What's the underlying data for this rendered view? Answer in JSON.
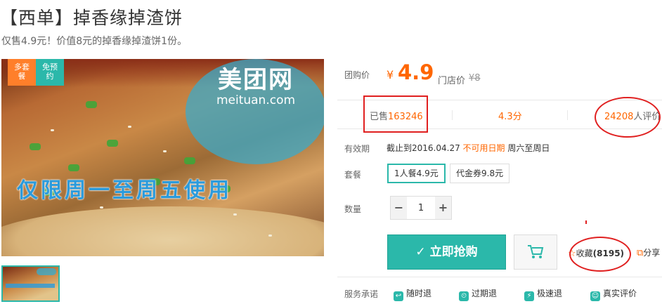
{
  "deal": {
    "title": "【西单】掉香缘掉渣饼",
    "subtitle": "仅售4.9元！价值8元的掉香缘掉渣饼1份。"
  },
  "image": {
    "badge_left": "多套餐",
    "badge_right": "免预约",
    "watermark_cn": "美团网",
    "watermark_en": "meituan.com",
    "promo_text": "仅限周一至周五使用"
  },
  "price": {
    "label": "团购价",
    "currency": "¥",
    "value": "4.9",
    "store_label": "门店价",
    "store_value": "¥8"
  },
  "stats": {
    "sold_label": "已售",
    "sold_count": "163246",
    "rating": "4.3分",
    "review_count": "24208",
    "review_suffix": "人评价"
  },
  "validity": {
    "label": "有效期",
    "until": "截止到2016.04.27",
    "unavailable_label": "不可用日期",
    "unavailable_days": "周六至周日"
  },
  "package": {
    "label": "套餐",
    "options": [
      "1人餐4.9元",
      "代金券9.8元"
    ],
    "selected_index": 0
  },
  "quantity": {
    "label": "数量",
    "minus": "−",
    "value": "1",
    "plus": "+"
  },
  "actions": {
    "buy_label": "✓ 立即抢购",
    "cart_icon": "cart-icon",
    "favorite_label": "收藏",
    "favorite_count": "(8195)",
    "share_label": "分享"
  },
  "services": {
    "label": "服务承诺",
    "items": [
      "随时退",
      "过期退",
      "极速退",
      "真实评价"
    ]
  },
  "colors": {
    "accent": "#2bb8aa",
    "price": "#ff6600",
    "annotation": "#e02020"
  }
}
